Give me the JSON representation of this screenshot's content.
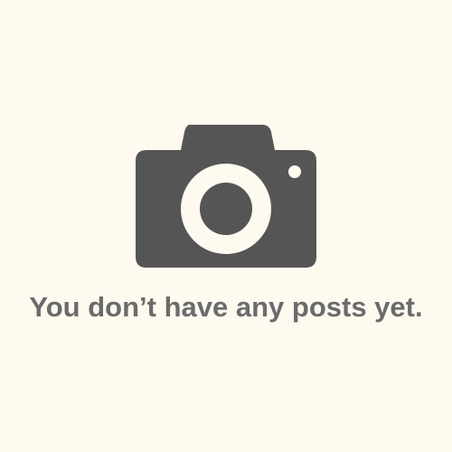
{
  "empty_state": {
    "icon": "camera-icon",
    "message": "You don’t have any posts yet."
  },
  "colors": {
    "background": "#fefaf0",
    "icon": "#555555",
    "text": "#6b6b6b"
  }
}
